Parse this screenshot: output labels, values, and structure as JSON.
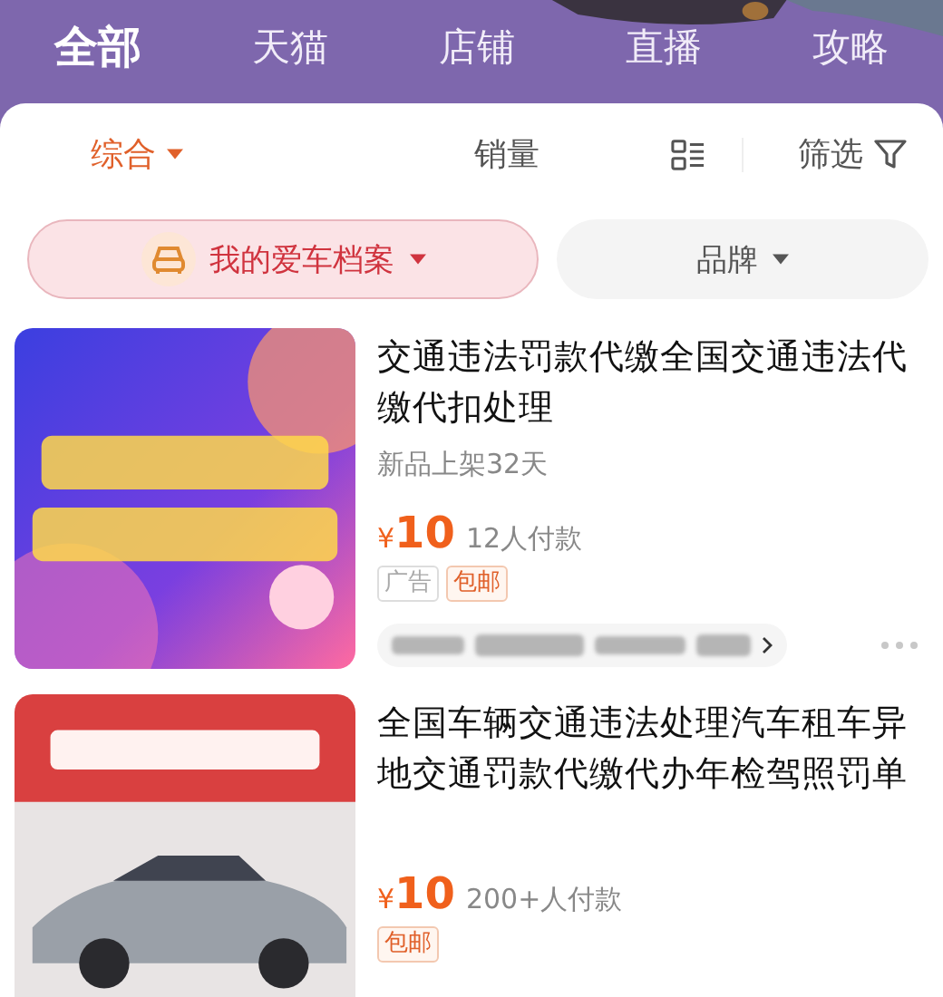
{
  "tabs": [
    {
      "label": "全部",
      "selected": true
    },
    {
      "label": "天猫",
      "selected": false
    },
    {
      "label": "店铺",
      "selected": false
    },
    {
      "label": "直播",
      "selected": false
    },
    {
      "label": "攻略",
      "selected": false
    }
  ],
  "sort_bar": {
    "items": [
      {
        "kind": "dropdown",
        "label": "综合",
        "selected": true
      },
      {
        "kind": "text",
        "label": "销量",
        "selected": false
      },
      {
        "kind": "layout",
        "selected": false
      },
      {
        "kind": "filter",
        "label": "筛选",
        "selected": false
      }
    ]
  },
  "chips": [
    {
      "kind": "car",
      "label": "我的爱车档案",
      "selected": true
    },
    {
      "kind": "plain",
      "label": "品牌",
      "selected": false
    }
  ],
  "products": [
    {
      "kind": "banner",
      "title": "交通违法罚款代缴全国交通违法代缴代扣处理",
      "subtitle": "新品上架32天",
      "currency": "¥",
      "price": "10",
      "sales": "12人付款",
      "tags": [
        {
          "kind": "ad",
          "text": "广告"
        },
        {
          "kind": "shipping",
          "text": "包邮"
        }
      ],
      "shop_link": true
    },
    {
      "kind": "car",
      "title": "全国车辆交通违法处理汽车租车异地交通罚款代缴代办年检驾照罚单",
      "currency": "¥",
      "price": "10",
      "sales": "200+人付款",
      "tags": [
        {
          "kind": "shipping",
          "text": "包邮"
        }
      ],
      "shop_link": false
    }
  ]
}
